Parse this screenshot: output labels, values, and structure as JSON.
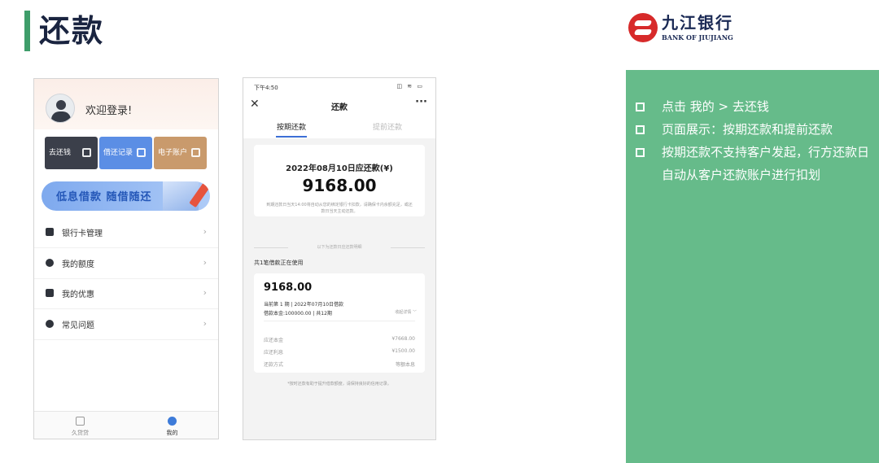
{
  "slide": {
    "title": "还款",
    "logo": {
      "name_cn": "九江银行",
      "name_en": "BANK OF JIUJIANG"
    },
    "bullets": [
      "点击 我的 > 去还钱",
      "页面展示：按期还款和提前还款",
      "按期还款不支持客户发起，行方还款日自动从客户还款账户进行扣划"
    ],
    "colors": {
      "accent_green": "#66bb8a",
      "title_bar": "#3e9d6a"
    }
  },
  "phone1": {
    "welcome": "欢迎登录!",
    "tiles": [
      {
        "label": "去还钱",
        "icon": "wallet-icon"
      },
      {
        "label": "借还记录",
        "icon": "document-icon"
      },
      {
        "label": "电子账户",
        "icon": "id-card-icon"
      }
    ],
    "banner": "低息借款 随借随还",
    "menu": [
      {
        "label": "银行卡管理",
        "icon": "card-icon"
      },
      {
        "label": "我的额度",
        "icon": "quota-icon"
      },
      {
        "label": "我的优惠",
        "icon": "coupon-icon"
      },
      {
        "label": "常见问题",
        "icon": "question-icon"
      }
    ],
    "chevron": "›",
    "tabs": [
      {
        "label": "久贷贷"
      },
      {
        "label": "我的"
      }
    ]
  },
  "phone2": {
    "status_time": "下午4:50",
    "status_icons": "◫ ≋ ▭",
    "nav": {
      "close": "✕",
      "title": "还款",
      "more": "···"
    },
    "segments": {
      "active": "按期还款",
      "inactive": "提前还款"
    },
    "due": {
      "heading": "2022年08月10日应还款(¥)",
      "amount": "9168.00",
      "note": "到期还款日当天14:00将自动从您的绑定银行卡扣款，请确保卡内余额充足，或还款日当天主动还款。"
    },
    "divider_text": "以下为还款日应还款明细",
    "in_use": "共1笔借款正在使用",
    "loan": {
      "amount": "9168.00",
      "line1": "当前第 1 期 | 2022年07月10日借款",
      "line2": "借款本金:100000.00 | 共12期",
      "toggle": "收起详情 ﹀",
      "rows": [
        {
          "k": "应还本金",
          "v": "¥7668.00"
        },
        {
          "k": "应还利息",
          "v": "¥1500.00"
        },
        {
          "k": "还款方式",
          "v": "等额本息"
        }
      ]
    },
    "footnote": "*按时还款有助于提升借款额度，请保持良好的信用记录。"
  }
}
